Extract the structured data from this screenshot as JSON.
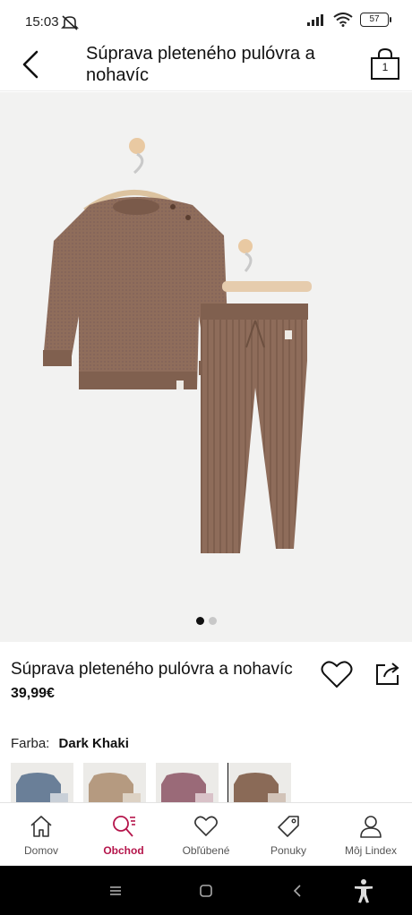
{
  "status_bar": {
    "time": "15:03",
    "battery": "57",
    "icons": [
      "mute-icon",
      "signal-icon",
      "wifi-icon",
      "battery-icon"
    ]
  },
  "header": {
    "title": "Súprava pleteného pulóvra a nohavíc",
    "cart_count": "1"
  },
  "gallery": {
    "slides": 2,
    "active_slide": 1
  },
  "product": {
    "title": "Súprava pleteného pulóvra a nohavíc",
    "price": "39,99€",
    "color_label": "Farba:",
    "color_value": "Dark Khaki"
  },
  "swatches": [
    {
      "color": "#6a7f98",
      "selected": false
    },
    {
      "color": "#b59a80",
      "selected": false
    },
    {
      "color": "#9a6a78",
      "selected": false
    },
    {
      "color": "#8a6a57",
      "selected": true
    }
  ],
  "bottom_nav": {
    "items": [
      {
        "label": "Domov",
        "icon": "home-icon",
        "active": false
      },
      {
        "label": "Obchod",
        "icon": "shop-search-icon",
        "active": true
      },
      {
        "label": "Obľúbené",
        "icon": "heart-icon",
        "active": false
      },
      {
        "label": "Ponuky",
        "icon": "tag-icon",
        "active": false
      },
      {
        "label": "Môj Lindex",
        "icon": "user-icon",
        "active": false
      }
    ]
  },
  "colors": {
    "accent": "#b5154b",
    "product_brown": "#8e6c5a"
  }
}
